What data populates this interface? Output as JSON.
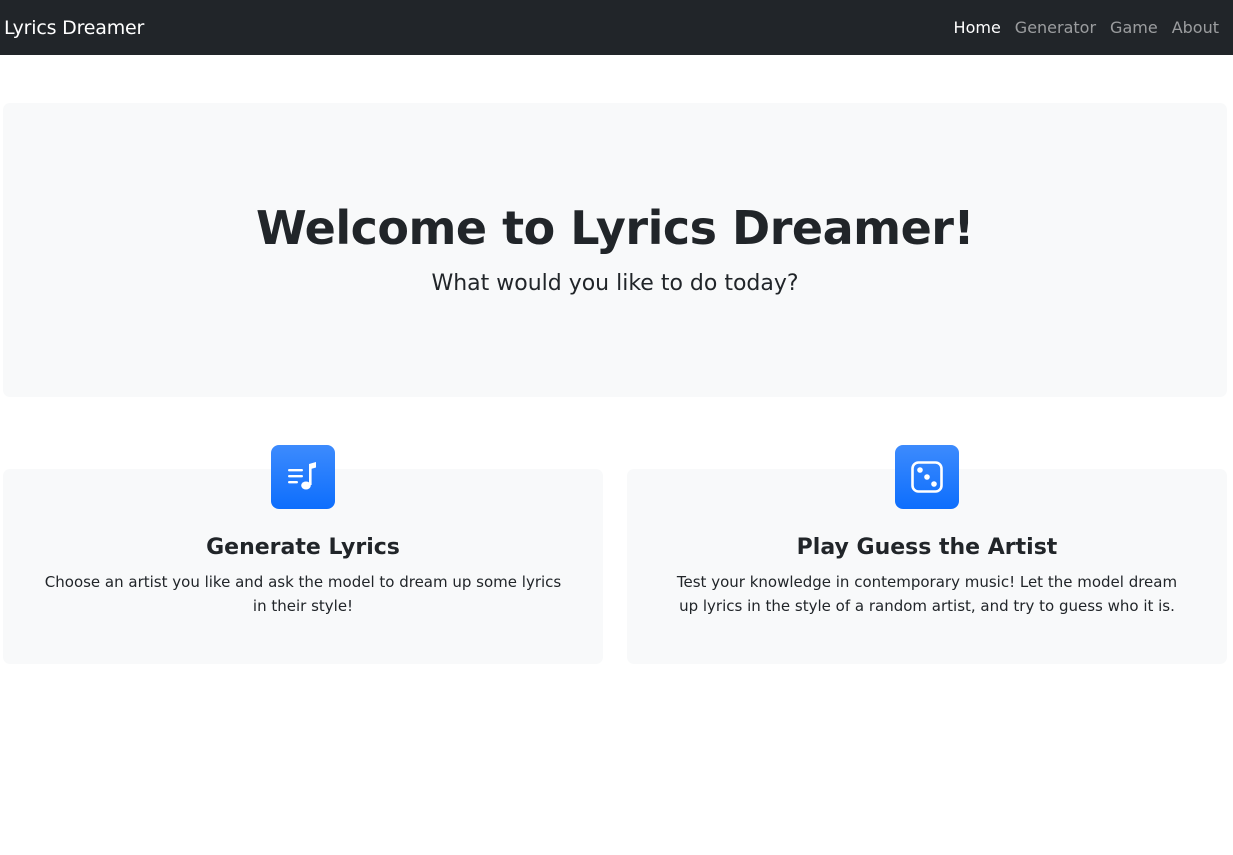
{
  "navbar": {
    "brand": "Lyrics Dreamer",
    "links": [
      {
        "label": "Home",
        "active": true
      },
      {
        "label": "Generator",
        "active": false
      },
      {
        "label": "Game",
        "active": false
      },
      {
        "label": "About",
        "active": false
      }
    ]
  },
  "hero": {
    "title": "Welcome to Lyrics Dreamer!",
    "subtitle": "What would you like to do today?"
  },
  "features": [
    {
      "icon": "music-note-list-icon",
      "title": "Generate Lyrics",
      "text": "Choose an artist you like and ask the model to dream up some lyrics in their style!"
    },
    {
      "icon": "dice-icon",
      "title": "Play Guess the Artist",
      "text": "Test your knowledge in contemporary music! Let the model dream up lyrics in the style of a random artist, and try to guess who it is."
    }
  ],
  "colors": {
    "navbar_bg": "#212529",
    "accent": "#0d6efd",
    "panel_bg": "#f8f9fa"
  }
}
